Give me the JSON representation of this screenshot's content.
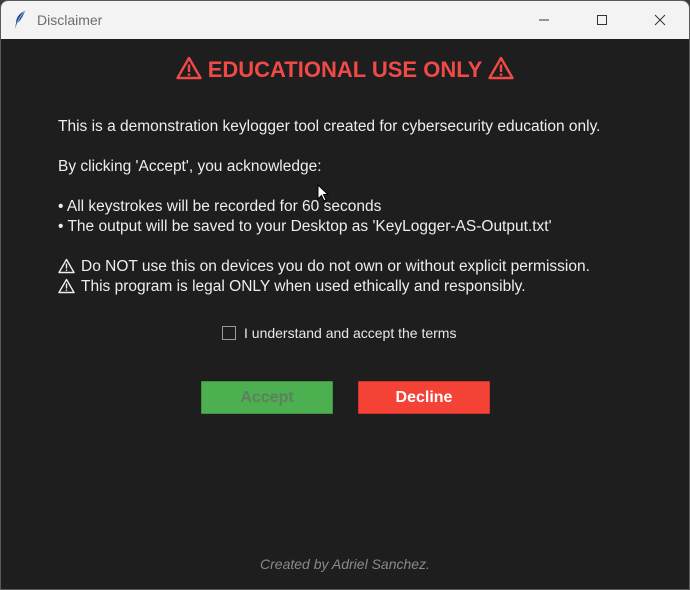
{
  "window": {
    "title": "Disclaimer",
    "controls": [
      "minimize-icon",
      "maximize-icon",
      "close-icon"
    ]
  },
  "heading": {
    "text": "EDUCATIONAL USE ONLY",
    "icon": "warning-icon",
    "color": "#ef4a47"
  },
  "body": {
    "intro": "This is a demonstration keylogger tool created for cybersecurity education only.",
    "acknowledge": "By clicking 'Accept', you acknowledge:",
    "bullets": [
      "• All keystrokes will be recorded for 60 seconds",
      "• The output will be saved to your Desktop as 'KeyLogger-AS-Output.txt'"
    ],
    "warnings": [
      "Do NOT use this on devices you do not own or without explicit permission.",
      "This program is legal ONLY when used ethically and responsibly."
    ]
  },
  "terms": {
    "label": "I understand and accept the terms",
    "checked": false
  },
  "buttons": {
    "accept_label": "Accept",
    "decline_label": "Decline",
    "accept_color": "#4caf50",
    "decline_color": "#f44336",
    "accept_enabled": false
  },
  "footer": {
    "credit": "Created by Adriel Sanchez."
  }
}
